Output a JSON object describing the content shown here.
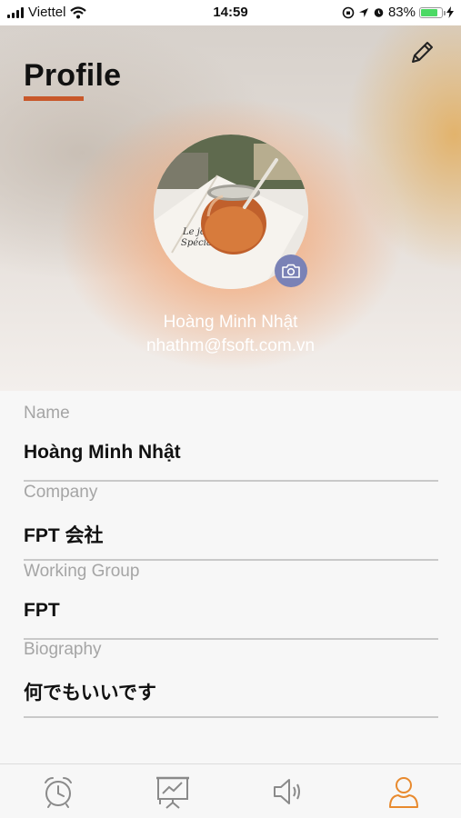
{
  "status": {
    "carrier": "Viettel",
    "time": "14:59",
    "battery": "83%",
    "battery_level": 0.83
  },
  "header": {
    "title": "Profile",
    "name": "Hoàng Minh Nhật",
    "email": "nhathm@fsoft.com.vn"
  },
  "fields": [
    {
      "label": "Name",
      "value": "Hoàng Minh Nhật"
    },
    {
      "label": "Company",
      "value": "FPT 会社"
    },
    {
      "label": "Working Group",
      "value": "FPT"
    },
    {
      "label": "Biography",
      "value": "何でもいいです"
    }
  ],
  "tabs": [
    {
      "icon": "alarm-clock-icon",
      "active": false
    },
    {
      "icon": "presentation-icon",
      "active": false
    },
    {
      "icon": "speaker-icon",
      "active": false
    },
    {
      "icon": "user-profile-icon",
      "active": true
    }
  ],
  "colors": {
    "accent": "#e88a2e",
    "title_underline": "#c8582a",
    "camera_button": "#7a82b6",
    "inactive_icon": "#8a8a8a"
  }
}
